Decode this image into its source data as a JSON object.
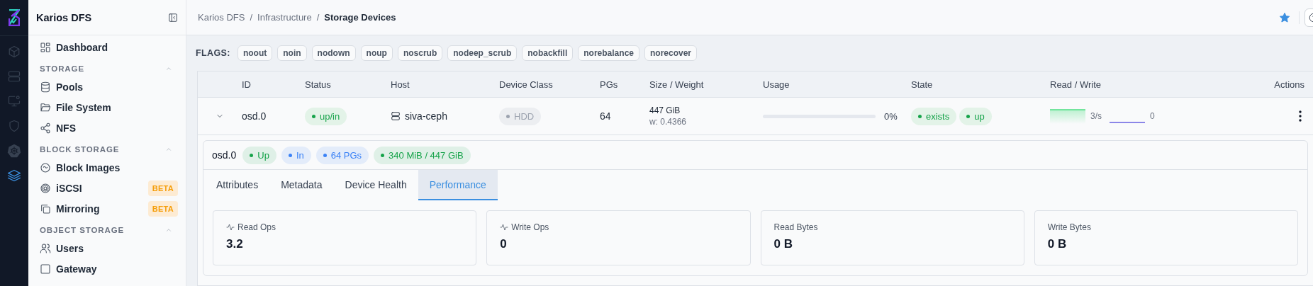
{
  "rail": {
    "items": [
      {
        "selected": false
      },
      {
        "selected": false
      },
      {
        "selected": false
      },
      {
        "selected": false
      },
      {
        "selected": false
      },
      {
        "selected": true
      }
    ]
  },
  "sidebar": {
    "title": "Karios DFS",
    "dashboard": {
      "label": "Dashboard"
    },
    "sections": [
      {
        "title": "STORAGE",
        "expanded": true,
        "items": [
          {
            "label": "Pools"
          },
          {
            "label": "File System"
          },
          {
            "label": "NFS"
          }
        ]
      },
      {
        "title": "BLOCK STORAGE",
        "expanded": true,
        "items": [
          {
            "label": "Block Images"
          },
          {
            "label": "iSCSI",
            "badge": "BETA"
          },
          {
            "label": "Mirroring",
            "badge": "BETA"
          }
        ]
      },
      {
        "title": "OBJECT STORAGE",
        "expanded": true,
        "items": [
          {
            "label": "Users"
          },
          {
            "label": "Gateway"
          }
        ]
      }
    ]
  },
  "header": {
    "breadcrumbs": [
      "Karios DFS",
      "Infrastructure",
      "Storage Devices"
    ],
    "separator": "/",
    "starred": true
  },
  "flags": {
    "label": "FLAGS:",
    "items": [
      "noout",
      "noin",
      "nodown",
      "noup",
      "noscrub",
      "nodeep_scrub",
      "nobackfill",
      "norebalance",
      "norecover"
    ]
  },
  "table": {
    "columns": [
      "ID",
      "Status",
      "Host",
      "Device Class",
      "PGs",
      "Size / Weight",
      "Usage",
      "State",
      "Read / Write",
      "Actions"
    ],
    "rows": [
      {
        "expanded": true,
        "id": "osd.0",
        "status": "up/in",
        "host": "siva-ceph",
        "device_class": "HDD",
        "pgs": "64",
        "size": "447 GiB",
        "weight": "w: 0.4366",
        "usage": {
          "level": 0,
          "reading": "0%"
        },
        "states": [
          "exists",
          "up"
        ],
        "read_rate": "3/s",
        "write_rate": "0"
      }
    ]
  },
  "detail": {
    "title": "osd.0",
    "badges": [
      {
        "label": "Up",
        "color": "#16a34a"
      },
      {
        "label": "In",
        "color": "#3b82f6"
      },
      {
        "label": "64 PGs",
        "color": "#3b82f6"
      },
      {
        "label": "340 MiB / 447 GiB",
        "color": "#16a34a"
      }
    ],
    "tabs": [
      {
        "label": "Attributes",
        "selected": false
      },
      {
        "label": "Metadata",
        "selected": false
      },
      {
        "label": "Device Health",
        "selected": false
      },
      {
        "label": "Performance",
        "selected": true
      }
    ],
    "stats": [
      {
        "kind": "ops",
        "label": "Read Ops",
        "value": "3.2"
      },
      {
        "kind": "ops",
        "label": "Write Ops",
        "value": "0"
      },
      {
        "kind": "bytes",
        "label": "Read Bytes",
        "value": "0 B"
      },
      {
        "kind": "bytes",
        "label": "Write Bytes",
        "value": "0 B"
      }
    ]
  }
}
